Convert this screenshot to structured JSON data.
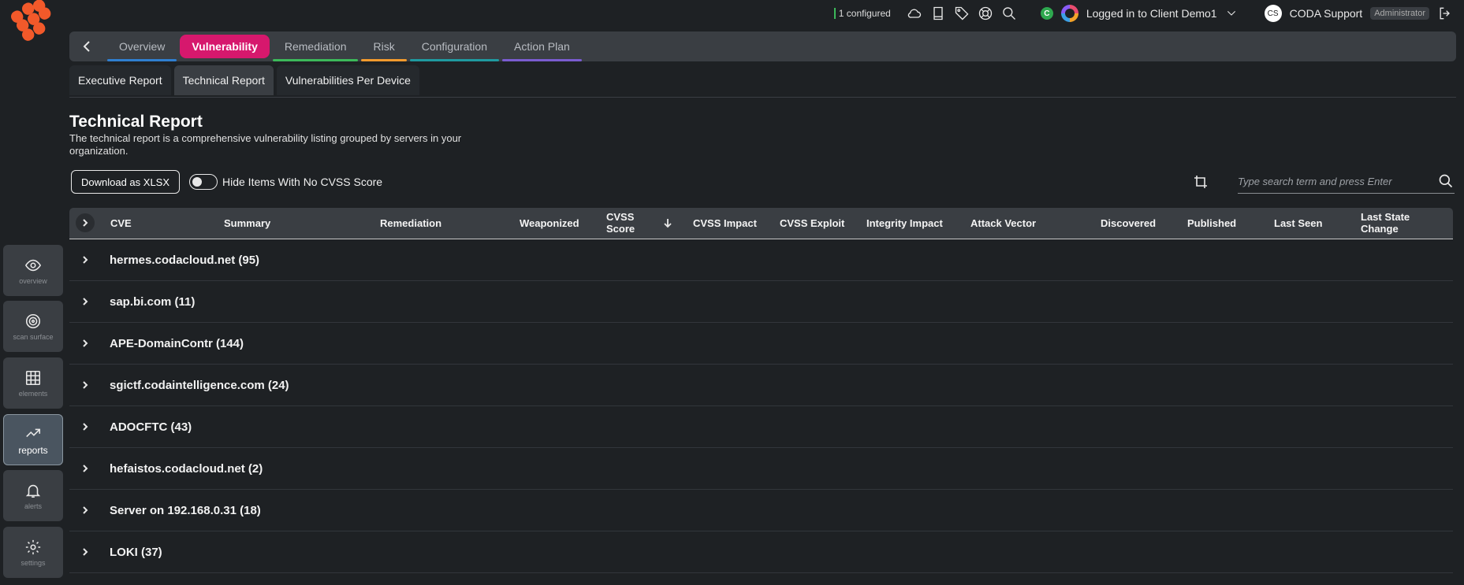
{
  "topbar": {
    "configured": "1 configured",
    "c_badge": "C",
    "client_label": "Logged in to Client Demo1",
    "avatar_initials": "CS",
    "user_name": "CODA Support",
    "role": "Administrator"
  },
  "main_tabs": [
    {
      "label": "Overview",
      "color": "#2f7fd0"
    },
    {
      "label": "Vulnerability",
      "color": "#d6186d"
    },
    {
      "label": "Remediation",
      "color": "#3cb95a"
    },
    {
      "label": "Risk",
      "color": "#f29a2e"
    },
    {
      "label": "Configuration",
      "color": "#1f9aa0"
    },
    {
      "label": "Action Plan",
      "color": "#7a5cd0"
    }
  ],
  "sub_tabs": [
    {
      "label": "Executive Report"
    },
    {
      "label": "Technical Report"
    },
    {
      "label": "Vulnerabilities Per Device"
    }
  ],
  "page": {
    "title": "Technical Report",
    "description": "The technical report is a comprehensive vulnerability listing grouped by servers in your organization."
  },
  "controls": {
    "download_label": "Download as XLSX",
    "toggle_label": "Hide Items With No CVSS Score",
    "search_placeholder": "Type search term and press Enter"
  },
  "table": {
    "columns": [
      "CVE",
      "Summary",
      "Remediation",
      "Weaponized",
      "CVSS Score",
      "CVSS Impact",
      "CVSS Exploit",
      "Integrity Impact",
      "Attack Vector",
      "Discovered",
      "Published",
      "Last Seen",
      "Last State Change"
    ],
    "groups": [
      "hermes.codacloud.net (95)",
      "sap.bi.com (11)",
      "APE-DomainContr (144)",
      "sgictf.codaintelligence.com (24)",
      "ADOCFTC (43)",
      "hefaistos.codacloud.net (2)",
      "Server on 192.168.0.31 (18)",
      "LOKI (37)"
    ]
  },
  "sidebar": [
    {
      "label": "overview",
      "icon": "eye-icon"
    },
    {
      "label": "scan surface",
      "icon": "target-icon"
    },
    {
      "label": "elements",
      "icon": "grid-icon"
    },
    {
      "label": "reports",
      "icon": "trend-icon"
    },
    {
      "label": "alerts",
      "icon": "bell-icon"
    },
    {
      "label": "settings",
      "icon": "gear-icon"
    }
  ]
}
